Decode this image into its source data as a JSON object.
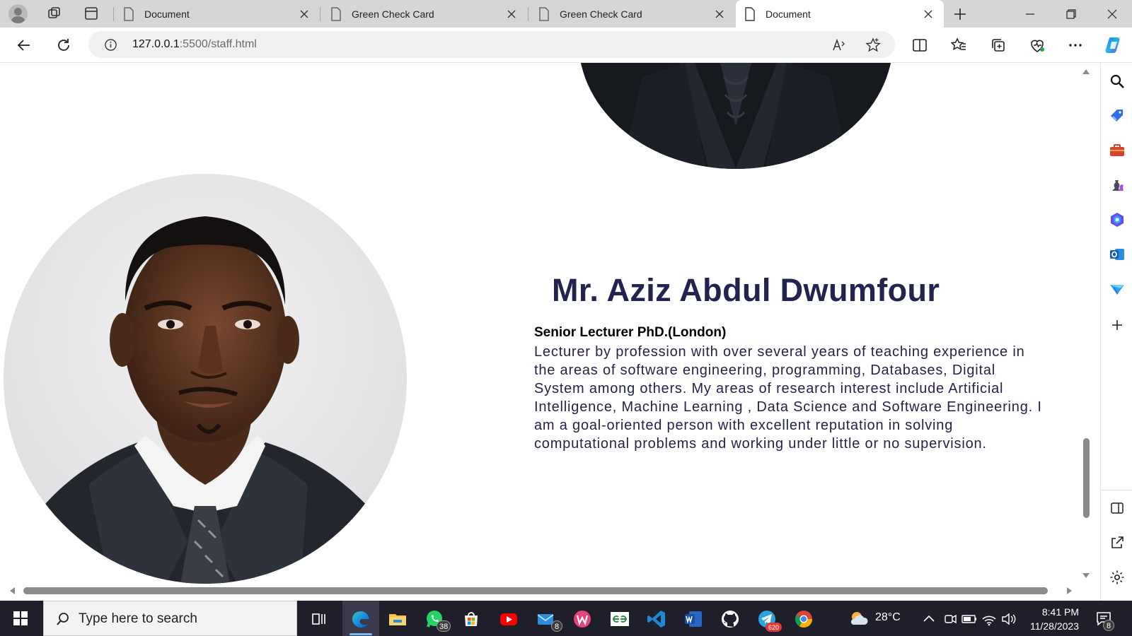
{
  "browser": {
    "tabs": [
      {
        "label": "Document",
        "active": false
      },
      {
        "label": "Green Check Card",
        "active": false
      },
      {
        "label": "Green Check Card",
        "active": false
      },
      {
        "label": "Document",
        "active": true
      }
    ],
    "url_host": "127.0.0.1",
    "url_rest": ":5500/staff.html"
  },
  "page": {
    "staff_name": "Mr. Aziz Abdul Dwumfour",
    "staff_role": "Senior Lecturer PhD.(London)",
    "staff_bio": "Lecturer by profession with over several years of teaching experience in the areas of software engineering, programming, Databases, Digital System among others. My areas of research interest include Artificial Intelligence, Machine Learning , Data Science and Software Engineering. I am a goal-oriented person with excellent reputation in solving computational problems and working under little or no supervision."
  },
  "taskbar": {
    "search_placeholder": "Type here to search",
    "whatsapp_badge": "38",
    "mail_badge": "8",
    "telegram_badge": "620",
    "weather": "28°C",
    "time": "8:41 PM",
    "date": "11/28/2023",
    "notification_badge": "8"
  },
  "colors": {
    "name_color": "#23234f",
    "bio_color": "#23234f",
    "taskbar_bg": "#1f1f2b"
  }
}
